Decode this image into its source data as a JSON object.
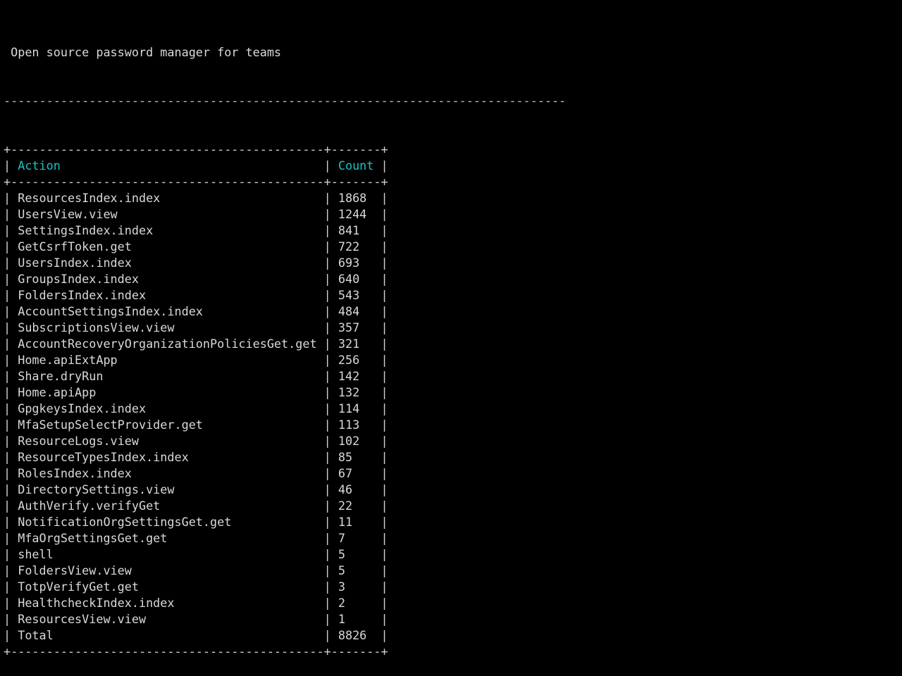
{
  "terminal": {
    "subtitle": "Open source password manager for teams",
    "separator_length": 79
  },
  "table": {
    "columns": [
      "Action",
      "Count"
    ],
    "header_color": "#1ac3c6",
    "rows": [
      {
        "action": "ResourcesIndex.index",
        "count": "1868"
      },
      {
        "action": "UsersView.view",
        "count": "1244"
      },
      {
        "action": "SettingsIndex.index",
        "count": "841"
      },
      {
        "action": "GetCsrfToken.get",
        "count": "722"
      },
      {
        "action": "UsersIndex.index",
        "count": "693"
      },
      {
        "action": "GroupsIndex.index",
        "count": "640"
      },
      {
        "action": "FoldersIndex.index",
        "count": "543"
      },
      {
        "action": "AccountSettingsIndex.index",
        "count": "484"
      },
      {
        "action": "SubscriptionsView.view",
        "count": "357"
      },
      {
        "action": "AccountRecoveryOrganizationPoliciesGet.get",
        "count": "321"
      },
      {
        "action": "Home.apiExtApp",
        "count": "256"
      },
      {
        "action": "Share.dryRun",
        "count": "142"
      },
      {
        "action": "Home.apiApp",
        "count": "132"
      },
      {
        "action": "GpgkeysIndex.index",
        "count": "114"
      },
      {
        "action": "MfaSetupSelectProvider.get",
        "count": "113"
      },
      {
        "action": "ResourceLogs.view",
        "count": "102"
      },
      {
        "action": "ResourceTypesIndex.index",
        "count": "85"
      },
      {
        "action": "RolesIndex.index",
        "count": "67"
      },
      {
        "action": "DirectorySettings.view",
        "count": "46"
      },
      {
        "action": "AuthVerify.verifyGet",
        "count": "22"
      },
      {
        "action": "NotificationOrgSettingsGet.get",
        "count": "11"
      },
      {
        "action": "MfaOrgSettingsGet.get",
        "count": "7"
      },
      {
        "action": "shell",
        "count": "5"
      },
      {
        "action": "FoldersView.view",
        "count": "5"
      },
      {
        "action": "TotpVerifyGet.get",
        "count": "3"
      },
      {
        "action": "HealthcheckIndex.index",
        "count": "2"
      },
      {
        "action": "ResourcesView.view",
        "count": "1"
      }
    ],
    "total": {
      "action": "Total",
      "count": "8826"
    }
  }
}
